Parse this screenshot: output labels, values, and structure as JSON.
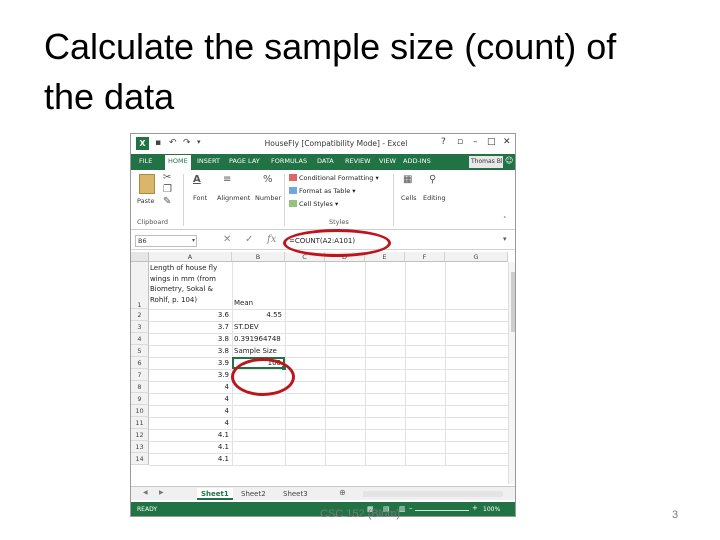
{
  "slide": {
    "title_line1": "Calculate the sample size (count) of",
    "title_line2": "the data",
    "footer": "CSC 152 (Blum)",
    "page_number": "3"
  },
  "excel": {
    "title": "HouseFly [Compatibility Mode] - Excel",
    "tabs": [
      {
        "label": "FILE"
      },
      {
        "label": "HOME",
        "active": true
      },
      {
        "label": "INSERT"
      },
      {
        "label": "PAGE LAY"
      },
      {
        "label": "FORMULAS"
      },
      {
        "label": "DATA"
      },
      {
        "label": "REVIEW"
      },
      {
        "label": "VIEW"
      },
      {
        "label": "ADD-INS"
      }
    ],
    "user": "Thomas Bl...",
    "ribbon": {
      "paste": "Paste",
      "clipboard": "Clipboard",
      "font": "Font",
      "alignment": "Alignment",
      "number": "Number",
      "conditional_formatting": "Conditional Formatting",
      "format_as_table": "Format as Table",
      "cell_styles": "Cell Styles",
      "styles": "Styles",
      "cells": "Cells",
      "editing": "Editing"
    },
    "name_box": "B6",
    "formula": "=COUNT(A2:A101)",
    "columns": [
      "A",
      "B",
      "C",
      "D",
      "E",
      "F",
      "G"
    ],
    "rows": [
      {
        "num": "1",
        "a_lines": [
          "Length of house fly",
          "wings in mm (from",
          "Biometry, Sokal &",
          "Rohlf, p. 104)"
        ],
        "b": "Mean"
      },
      {
        "num": "2",
        "a": "3.6",
        "b": "4.55"
      },
      {
        "num": "3",
        "a": "3.7",
        "b": "ST.DEV"
      },
      {
        "num": "4",
        "a": "3.8",
        "b": "0.391964748"
      },
      {
        "num": "5",
        "a": "3.8",
        "b": "Sample Size"
      },
      {
        "num": "6",
        "a": "3.9",
        "b": "100"
      },
      {
        "num": "7",
        "a": "3.9",
        "b": ""
      },
      {
        "num": "8",
        "a": "4",
        "b": ""
      },
      {
        "num": "9",
        "a": "4",
        "b": ""
      },
      {
        "num": "10",
        "a": "4",
        "b": ""
      },
      {
        "num": "11",
        "a": "4",
        "b": ""
      },
      {
        "num": "12",
        "a": "4.1",
        "b": ""
      },
      {
        "num": "13",
        "a": "4.1",
        "b": ""
      },
      {
        "num": "14",
        "a": "4.1",
        "b": ""
      }
    ],
    "sheets": [
      {
        "label": "Sheet1",
        "active": true
      },
      {
        "label": "Sheet2"
      },
      {
        "label": "Sheet3"
      }
    ],
    "status": "READY",
    "zoom": "100%"
  },
  "colors": {
    "excel_green": "#217346",
    "annotation_red": "#c0141c"
  },
  "icons": [
    "excel-logo-icon",
    "save-icon",
    "undo-icon",
    "redo-icon",
    "help-icon",
    "minimize-icon",
    "maximize-icon",
    "close-icon",
    "paste-icon",
    "cut-icon",
    "copy-icon",
    "format-painter-icon",
    "font-icon",
    "alignment-icon",
    "percent-icon",
    "cells-icon",
    "editing-icon",
    "cancel-x-icon",
    "enter-check-icon",
    "function-fx-icon",
    "add-sheet-icon"
  ]
}
